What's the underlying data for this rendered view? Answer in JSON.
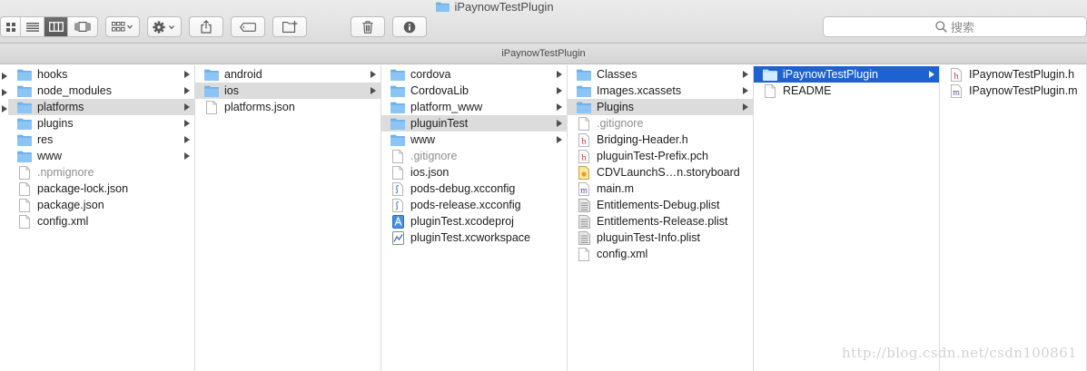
{
  "window": {
    "title": "iPaynowTestPlugin"
  },
  "toolbar": {
    "search_placeholder": "搜索"
  },
  "pathbar": {
    "title": "iPaynowTestPlugin"
  },
  "colors": {
    "folder": "#6db1ec",
    "selection_active": "#1d62d0",
    "selection_inactive": "#dcdcdc"
  },
  "columns": [
    {
      "items": [
        {
          "name": "hooks",
          "kind": "folder",
          "arrow": true
        },
        {
          "name": "node_modules",
          "kind": "folder",
          "arrow": true
        },
        {
          "name": "platforms",
          "kind": "folder",
          "arrow": true,
          "selected": "gray"
        },
        {
          "name": "plugins",
          "kind": "folder",
          "arrow": true
        },
        {
          "name": "res",
          "kind": "folder",
          "arrow": true
        },
        {
          "name": "www",
          "kind": "folder",
          "arrow": true
        },
        {
          "name": ".npmignore",
          "kind": "file",
          "dim": true
        },
        {
          "name": "package-lock.json",
          "kind": "file"
        },
        {
          "name": "package.json",
          "kind": "file"
        },
        {
          "name": "config.xml",
          "kind": "file"
        }
      ]
    },
    {
      "items": [
        {
          "name": "android",
          "kind": "folder",
          "arrow": true
        },
        {
          "name": "ios",
          "kind": "folder",
          "arrow": true,
          "selected": "gray"
        },
        {
          "name": "platforms.json",
          "kind": "file"
        }
      ]
    },
    {
      "items": [
        {
          "name": "cordova",
          "kind": "folder",
          "arrow": true
        },
        {
          "name": "CordovaLib",
          "kind": "folder",
          "arrow": true
        },
        {
          "name": "platform_www",
          "kind": "folder",
          "arrow": true
        },
        {
          "name": "pluguinTest",
          "kind": "folder",
          "arrow": true,
          "selected": "gray"
        },
        {
          "name": "www",
          "kind": "folder",
          "arrow": true
        },
        {
          "name": ".gitignore",
          "kind": "file",
          "dim": true
        },
        {
          "name": "ios.json",
          "kind": "file"
        },
        {
          "name": "pods-debug.xcconfig",
          "kind": "xcconfig"
        },
        {
          "name": "pods-release.xcconfig",
          "kind": "xcconfig"
        },
        {
          "name": "pluginTest.xcodeproj",
          "kind": "xcodeproj"
        },
        {
          "name": "pluginTest.xcworkspace",
          "kind": "xcworkspace"
        }
      ]
    },
    {
      "items": [
        {
          "name": "Classes",
          "kind": "folder",
          "arrow": true
        },
        {
          "name": "Images.xcassets",
          "kind": "folder",
          "arrow": true
        },
        {
          "name": "Plugins",
          "kind": "folder",
          "arrow": true,
          "selected": "gray"
        },
        {
          "name": ".gitignore",
          "kind": "file",
          "dim": true
        },
        {
          "name": "Bridging-Header.h",
          "kind": "h"
        },
        {
          "name": "pluguinTest-Prefix.pch",
          "kind": "h"
        },
        {
          "name": "CDVLaunchS…n.storyboard",
          "kind": "storyboard"
        },
        {
          "name": "main.m",
          "kind": "m"
        },
        {
          "name": "Entitlements-Debug.plist",
          "kind": "plist"
        },
        {
          "name": "Entitlements-Release.plist",
          "kind": "plist"
        },
        {
          "name": "pluguinTest-Info.plist",
          "kind": "plist"
        },
        {
          "name": "config.xml",
          "kind": "file"
        }
      ]
    },
    {
      "items": [
        {
          "name": "iPaynowTestPlugin",
          "kind": "folder",
          "arrow": true,
          "selected": "blue"
        },
        {
          "name": "README",
          "kind": "file"
        }
      ]
    },
    {
      "items": [
        {
          "name": "IPaynowTestPlugin.h",
          "kind": "h"
        },
        {
          "name": "IPaynowTestPlugin.m",
          "kind": "m"
        }
      ]
    }
  ],
  "watermark": "http://blog.csdn.net/csdn100861"
}
